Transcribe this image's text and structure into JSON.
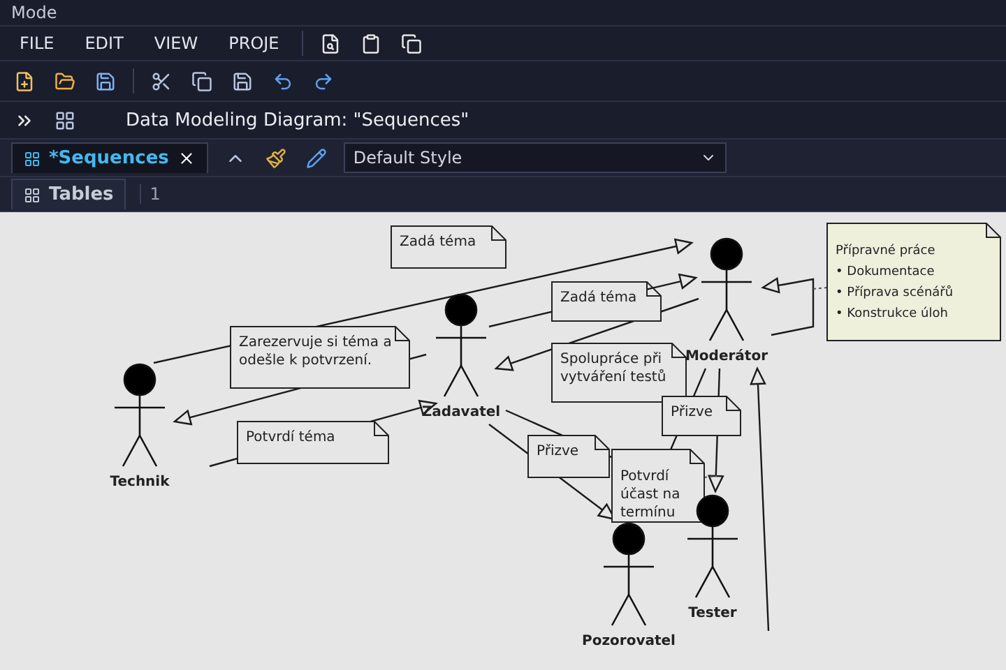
{
  "title_bar": {
    "title": "Mode"
  },
  "menu": [
    {
      "label": "FILE"
    },
    {
      "label": "EDIT"
    },
    {
      "label": "VIEW"
    },
    {
      "label": "PROJE"
    }
  ],
  "document_title": "Data Modeling Diagram: \"Sequences\"",
  "tabs": [
    {
      "label": "*Sequences",
      "selected": true
    }
  ],
  "style_select": {
    "value": "Default Style"
  },
  "panel_tabs": [
    {
      "label": "Tables",
      "selected": false
    }
  ],
  "zoom_field": {
    "value": "1"
  },
  "actors": [
    {
      "name": "Technik"
    },
    {
      "name": "Zadavatel"
    },
    {
      "name": "Moderátor"
    },
    {
      "name": "Pozorovatel"
    },
    {
      "name": "Tester"
    }
  ],
  "notes": [
    {
      "lines": [
        "Zadá téma"
      ]
    },
    {
      "lines": [
        "Zadá téma"
      ]
    },
    {
      "lines": [
        "Zarezervuje si téma a",
        "odešle k potvrzení."
      ]
    },
    {
      "lines": [
        "Spolupráce při",
        "vytváření testů"
      ]
    },
    {
      "lines": [
        "Potvrdí téma"
      ]
    },
    {
      "lines": [
        "Přizve"
      ]
    },
    {
      "lines": [
        "Přizve"
      ]
    },
    {
      "lines": [
        "Potvrdí",
        "účast na",
        "termínu"
      ]
    },
    {
      "lines": [
        "Přípravné práce",
        "• Dokumentace",
        "• Příprava scénářů",
        "• Konstrukce úloh"
      ]
    }
  ]
}
